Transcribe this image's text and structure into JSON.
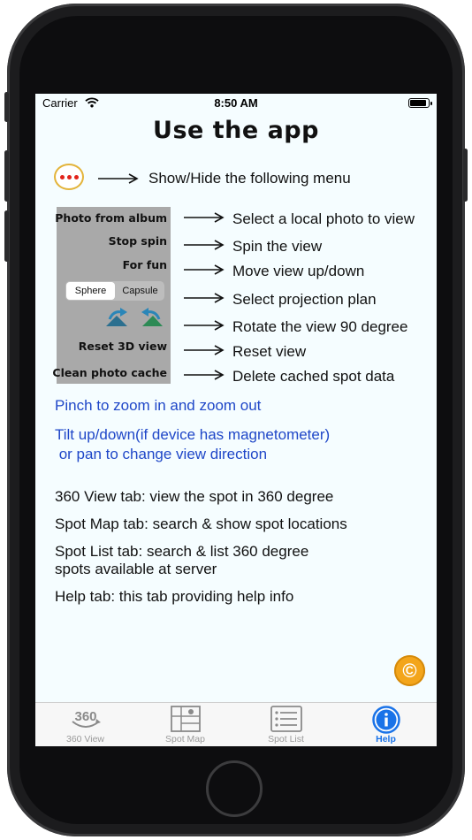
{
  "status_bar": {
    "carrier": "Carrier",
    "time": "8:50 AM",
    "battery_level": 0.9
  },
  "header": {
    "title": "Use the app"
  },
  "menu_toggle": {
    "description": "Show/Hide the following menu"
  },
  "menu_panel": {
    "items": {
      "photo_from_album": "Photo from album",
      "stop_spin": "Stop spin",
      "for_fun": "For fun",
      "reset_3d_view": "Reset 3D view",
      "clean_photo_cache": "Clean photo cache"
    },
    "segment": {
      "options": [
        "Sphere",
        "Capsule"
      ],
      "selected": "Sphere"
    }
  },
  "menu_explanations": [
    "Select a  local photo to view",
    "Spin the view",
    "Move view up/down",
    "Select projection plan",
    "Rotate the view 90 degree",
    "Reset view",
    "Delete cached spot data"
  ],
  "gestures": {
    "pinch": "Pinch to zoom in and zoom out",
    "tilt_line1": "Tilt up/down(if device has magnetometer)",
    "tilt_line2": " or pan to change view direction"
  },
  "tab_info": [
    "360 View tab: view the spot in 360 degree",
    "Spot Map tab: search & show spot locations",
    "Spot List tab: search & list 360 degree",
    "spots available at server",
    "Help tab: this tab providing help info"
  ],
  "copyright_icon": "©",
  "tabbar": {
    "tabs": [
      {
        "label": "360 View",
        "icon": "360-icon"
      },
      {
        "label": "Spot Map",
        "icon": "map-icon"
      },
      {
        "label": "Spot List",
        "icon": "list-icon"
      },
      {
        "label": "Help",
        "icon": "info-icon"
      }
    ],
    "active": "Help",
    "active_color": "#1a73e8"
  }
}
